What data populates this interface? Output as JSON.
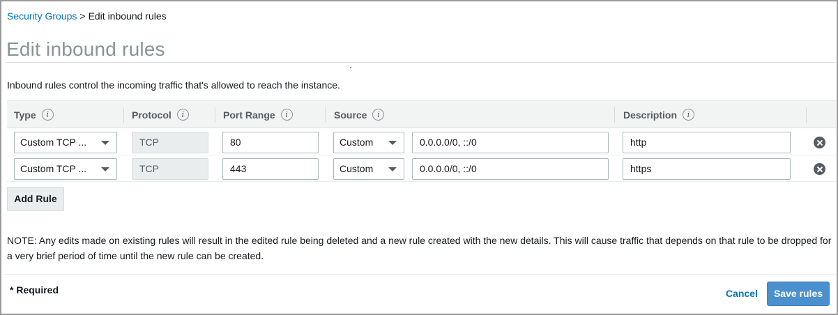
{
  "breadcrumb": {
    "parent": "Security Groups",
    "separator": ">",
    "current": "Edit inbound rules"
  },
  "page": {
    "title": "Edit inbound rules",
    "description": "Inbound rules control the incoming traffic that's allowed to reach the instance."
  },
  "table": {
    "headers": {
      "type": "Type",
      "protocol": "Protocol",
      "port_range": "Port Range",
      "source": "Source",
      "description": "Description"
    },
    "info_icon_glyph": "i",
    "rows": [
      {
        "type": "Custom TCP ...",
        "protocol": "TCP",
        "port_range": "80",
        "source_type": "Custom",
        "source_value": "0.0.0.0/0, ::/0",
        "description": "http"
      },
      {
        "type": "Custom TCP ...",
        "protocol": "TCP",
        "port_range": "443",
        "source_type": "Custom",
        "source_value": "0.0.0.0/0, ::/0",
        "description": "https"
      }
    ]
  },
  "actions": {
    "add_rule": "Add Rule",
    "cancel": "Cancel",
    "save": "Save rules"
  },
  "note": "NOTE: Any edits made on existing rules will result in the edited rule being deleted and a new rule created with the new details. This will cause traffic that depends on that rule to be dropped for a very brief period of time until the new rule can be created.",
  "required_label": "* Required",
  "colors": {
    "link": "#0073bb",
    "primary_button": "#4a8fce",
    "title": "#879596",
    "header_bg": "#f2f3f3"
  },
  "icons": {
    "info": "info-circle-icon",
    "remove": "remove-circle-icon",
    "dropdown": "caret-down-icon"
  }
}
